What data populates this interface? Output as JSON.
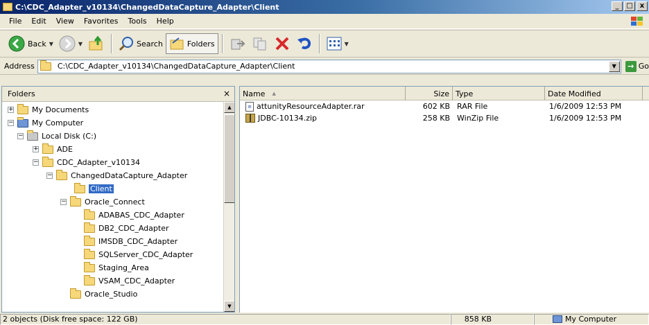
{
  "window": {
    "title": "C:\\CDC_Adapter_v10134\\ChangedDataCapture_Adapter\\Client",
    "controls": [
      "_",
      "□",
      "x"
    ]
  },
  "menu": [
    "File",
    "Edit",
    "View",
    "Favorites",
    "Tools",
    "Help"
  ],
  "toolbar": {
    "back": "Back",
    "search": "Search",
    "folders": "Folders"
  },
  "address": {
    "label": "Address",
    "path": "C:\\CDC_Adapter_v10134\\ChangedDataCapture_Adapter\\Client",
    "go": "Go"
  },
  "folders_pane": {
    "title": "Folders",
    "close": "×",
    "tree": [
      {
        "label": "My Documents",
        "expander": "+"
      },
      {
        "label": "My Computer",
        "expander": "−"
      },
      {
        "label": "Local Disk (C:)",
        "expander": "−"
      },
      {
        "label": "ADE",
        "expander": "+"
      },
      {
        "label": "CDC_Adapter_v10134",
        "expander": "−"
      },
      {
        "label": "ChangedDataCapture_Adapter",
        "expander": "−"
      },
      {
        "label": "Client",
        "expander": "",
        "selected": true
      },
      {
        "label": "Oracle_Connect",
        "expander": "−"
      },
      {
        "label": "ADABAS_CDC_Adapter",
        "expander": ""
      },
      {
        "label": "DB2_CDC_Adapter",
        "expander": ""
      },
      {
        "label": "IMSDB_CDC_Adapter",
        "expander": ""
      },
      {
        "label": "SQLServer_CDC_Adapter",
        "expander": ""
      },
      {
        "label": "Staging_Area",
        "expander": ""
      },
      {
        "label": "VSAM_CDC_Adapter",
        "expander": ""
      },
      {
        "label": "Oracle_Studio",
        "expander": ""
      }
    ]
  },
  "files": {
    "columns": {
      "name": "Name",
      "sort_arrow": "▲",
      "size": "Size",
      "type": "Type",
      "date": "Date Modified"
    },
    "rows": [
      {
        "name": "attunityResourceAdapter.rar",
        "size": "602 KB",
        "type": "RAR File",
        "date": "1/6/2009 12:53 PM",
        "icon": "rar-file-icon"
      },
      {
        "name": "JDBC-10134.zip",
        "size": "258 KB",
        "type": "WinZip File",
        "date": "1/6/2009 12:53 PM",
        "icon": "zip-file-icon"
      }
    ]
  },
  "status": {
    "objects": "2 objects (Disk free space: 122 GB)",
    "size": "858 KB",
    "location": "My Computer"
  }
}
